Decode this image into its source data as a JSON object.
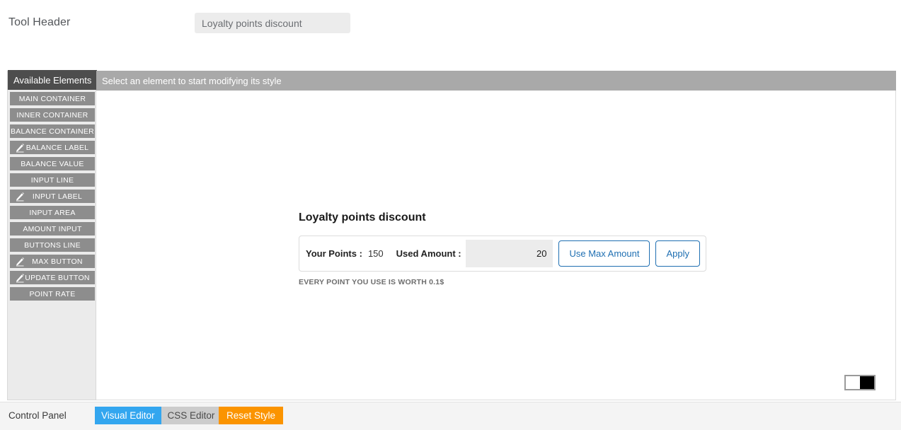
{
  "header": {
    "label": "Tool Header",
    "title_input_value": "Loyalty points discount",
    "title_input_placeholder": "Tool Header"
  },
  "sidebar": {
    "header": "Available Elements",
    "items": [
      {
        "label": "MAIN CONTAINER",
        "icon": ""
      },
      {
        "label": "INNER CONTAINER",
        "icon": ""
      },
      {
        "label": "BALANCE CONTAINER",
        "icon": ""
      },
      {
        "label": "BALANCE LABEL",
        "icon": "pencil-icon"
      },
      {
        "label": "BALANCE VALUE",
        "icon": ""
      },
      {
        "label": "INPUT LINE",
        "icon": ""
      },
      {
        "label": "INPUT LABEL",
        "icon": "pencil-icon"
      },
      {
        "label": "INPUT AREA",
        "icon": ""
      },
      {
        "label": "AMOUNT INPUT",
        "icon": ""
      },
      {
        "label": "BUTTONS LINE",
        "icon": ""
      },
      {
        "label": "MAX BUTTON",
        "icon": "pencil-icon"
      },
      {
        "label": "UPDATE BUTTON",
        "icon": "pencil-icon"
      },
      {
        "label": "POINT RATE",
        "icon": ""
      }
    ]
  },
  "canvas": {
    "topbar_message": "Select an element to start modifying its style",
    "widget": {
      "title": "Loyalty points discount",
      "balance_label": "Your Points :",
      "balance_value": "150",
      "input_label": "Used Amount :",
      "amount_value": "20",
      "amount_placeholder": "0",
      "max_button": "Use Max Amount",
      "apply_button": "Apply",
      "point_rate": "EVERY POINT YOU USE IS WORTH 0.1$"
    },
    "swatch": {
      "name": "black-white-swatch",
      "color_left": "#ffffff",
      "color_right": "#000000"
    }
  },
  "control_bar": {
    "label": "Control Panel",
    "tabs": [
      {
        "label": "Visual Editor",
        "active": true
      },
      {
        "label": "CSS Editor",
        "active": false
      }
    ],
    "reset_button": "Reset Style"
  },
  "colors": {
    "accent_blue": "#33a6ef",
    "accent_orange": "#fb9400",
    "sidebar_item_gray": "#8d8d8d",
    "sidebar_header_dark": "#4d4d4d",
    "canvas_topbar_gray": "#a9a9a9",
    "widget_button_blue": "#1f6fb2"
  }
}
